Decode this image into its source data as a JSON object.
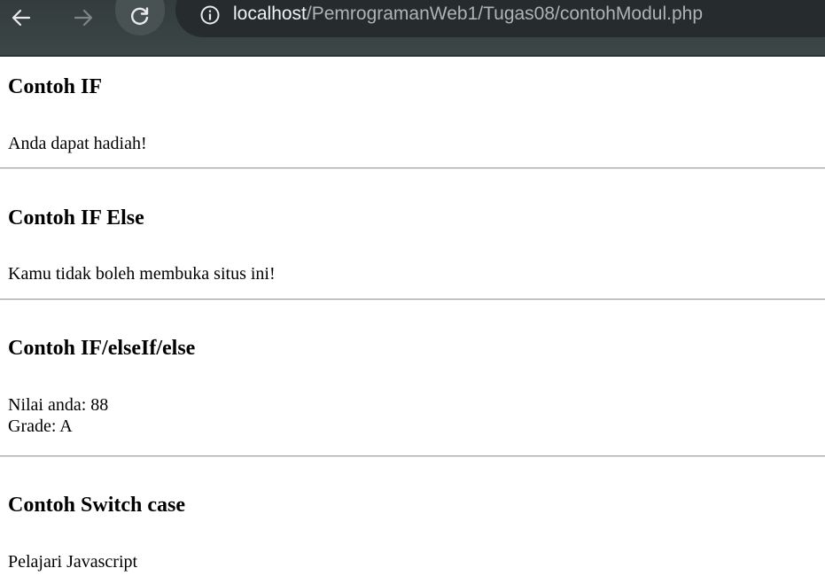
{
  "browser": {
    "url_host": "localhost",
    "url_path": "/PemrogramanWeb1/Tugas08/contohModul.php",
    "back_icon": "arrow-left-icon",
    "forward_icon": "arrow-right-icon",
    "reload_icon": "reload-icon",
    "site_info_icon": "info-circle-icon"
  },
  "sections": [
    {
      "title": "Contoh IF",
      "lines": [
        "Anda dapat hadiah!"
      ]
    },
    {
      "title": "Contoh IF Else",
      "lines": [
        "Kamu tidak boleh membuka situs ini!"
      ]
    },
    {
      "title": "Contoh IF/elseIf/else",
      "lines": [
        "Nilai anda: 88",
        "Grade: A"
      ]
    },
    {
      "title": "Contoh Switch case",
      "lines": [
        "Pelajari Javascript"
      ]
    }
  ],
  "colors": {
    "toolbar_bg": "#3c4647",
    "omnibox_bg": "#262c2d",
    "divider": "#9a9a9a"
  }
}
